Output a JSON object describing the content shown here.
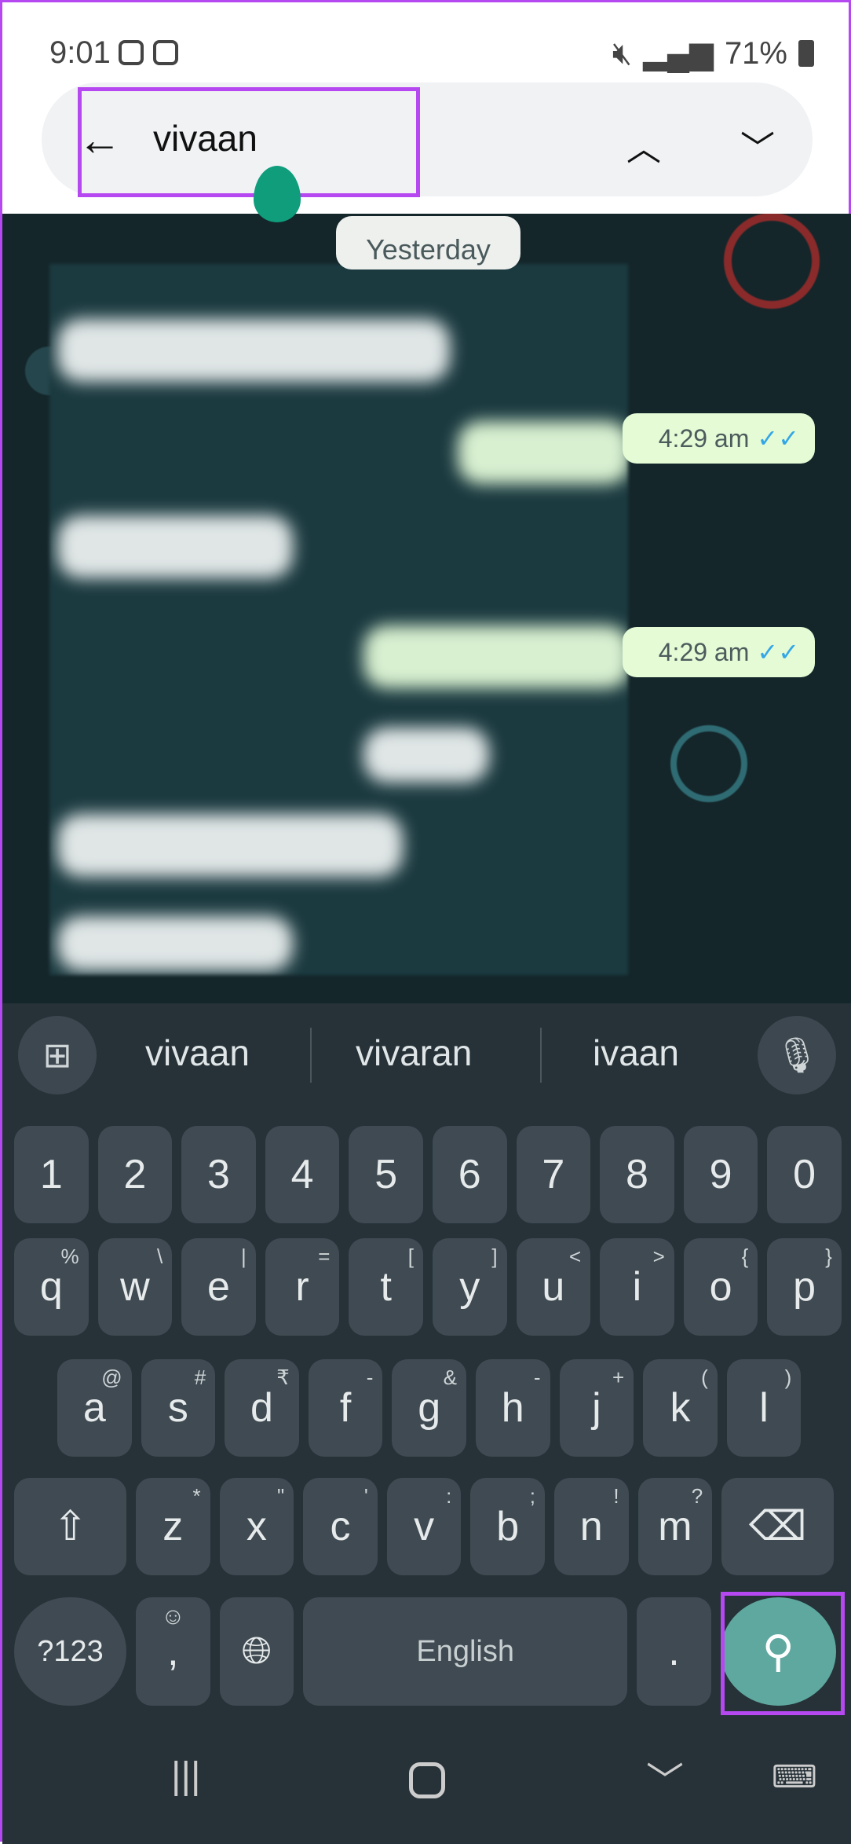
{
  "status": {
    "time": "9:01",
    "battery": "71%",
    "icons": [
      "instagram-icon",
      "gallery-icon",
      "battery-saver-icon",
      "mute-icon",
      "wifi-icon",
      "volte-icon",
      "signal-icon",
      "battery-icon"
    ]
  },
  "search": {
    "query": "vivaan",
    "back": "←",
    "up": "⌃",
    "down": "⌄"
  },
  "chat": {
    "date_chip": "Yesterday",
    "messages": [
      {
        "time": "4:29 am",
        "ticks": "✓✓"
      },
      {
        "time": "4:29 am",
        "ticks": "✓✓"
      }
    ]
  },
  "keyboard": {
    "suggestions": [
      "vivaan",
      "vivaran",
      "ivaan"
    ],
    "numbers": [
      "1",
      "2",
      "3",
      "4",
      "5",
      "6",
      "7",
      "8",
      "9",
      "0"
    ],
    "row1": [
      [
        "q",
        "%"
      ],
      [
        "w",
        "\\"
      ],
      [
        "e",
        "|"
      ],
      [
        "r",
        "="
      ],
      [
        "t",
        "["
      ],
      [
        "y",
        "]"
      ],
      [
        "u",
        "<"
      ],
      [
        "i",
        ">"
      ],
      [
        "o",
        "{"
      ],
      [
        "p",
        "}"
      ]
    ],
    "row2": [
      [
        "a",
        "@"
      ],
      [
        "s",
        "#"
      ],
      [
        "d",
        "₹"
      ],
      [
        "f",
        "-"
      ],
      [
        "g",
        "&"
      ],
      [
        "h",
        "-"
      ],
      [
        "j",
        "+"
      ],
      [
        "k",
        "("
      ],
      [
        "l",
        ")"
      ]
    ],
    "row3": [
      [
        "z",
        "*"
      ],
      [
        "x",
        "\""
      ],
      [
        "c",
        "'"
      ],
      [
        "v",
        ":"
      ],
      [
        "b",
        ";"
      ],
      [
        "n",
        "!"
      ],
      [
        "m",
        "?"
      ]
    ],
    "symbols": "?123",
    "comma": ",",
    "period": ".",
    "space": "English",
    "accent": "#5fa8a0"
  }
}
